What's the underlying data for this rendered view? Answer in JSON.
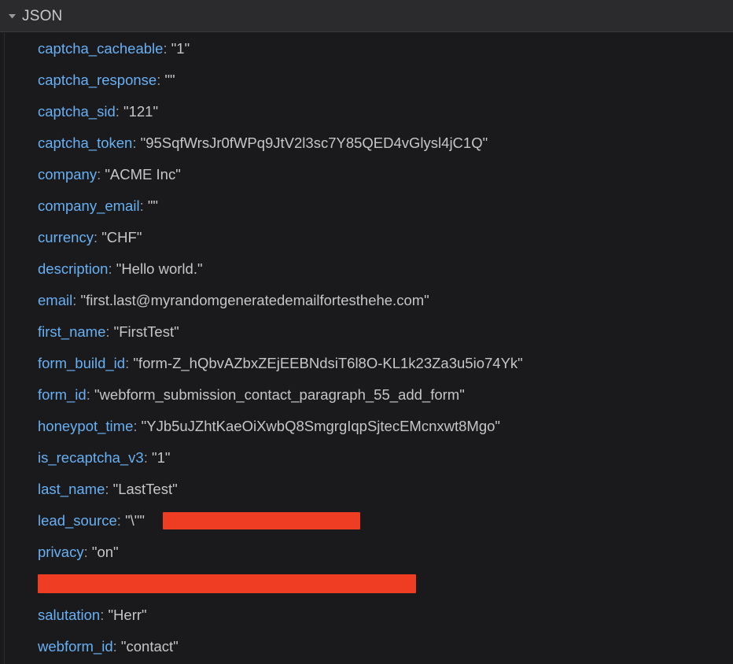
{
  "panel": {
    "title": "JSON",
    "disclosure_icon": "triangle-down-icon",
    "expanded": true,
    "colors": {
      "background": "#1a1a1c",
      "header_background": "#2b2b2e",
      "key": "#67b0f4",
      "value": "#c6c6c8",
      "punctuation": "#9a9a9e",
      "redaction": "#ee3d23"
    }
  },
  "entries": [
    {
      "key": "captcha_cacheable",
      "sep": ": ",
      "value": "\"1\"",
      "redacted": false
    },
    {
      "key": "captcha_response",
      "sep": ": ",
      "value": "\"\"",
      "redacted": false
    },
    {
      "key": "captcha_sid",
      "sep": ": ",
      "value": "\"121\"",
      "redacted": false
    },
    {
      "key": "captcha_token",
      "sep": ": ",
      "value": "\"95SqfWrsJr0fWPq9JtV2l3sc7Y85QED4vGlysl4jC1Q\"",
      "redacted": false
    },
    {
      "key": "company",
      "sep": ": ",
      "value": "\"ACME Inc\"",
      "redacted": false
    },
    {
      "key": "company_email",
      "sep": ": ",
      "value": "\"\"",
      "redacted": false
    },
    {
      "key": "currency",
      "sep": ": ",
      "value": "\"CHF\"",
      "redacted": false
    },
    {
      "key": "description",
      "sep": ": ",
      "value": "\"Hello world.\"",
      "redacted": false
    },
    {
      "key": "email",
      "sep": ": ",
      "value": "\"first.last@myrandomgeneratedemailfortesthehe.com\"",
      "redacted": false
    },
    {
      "key": "first_name",
      "sep": ": ",
      "value": "\"FirstTest\"",
      "redacted": false
    },
    {
      "key": "form_build_id",
      "sep": ": ",
      "value": "\"form-Z_hQbvAZbxZEjEEBNdsiT6l8O-KL1k23Za3u5io74Yk\"",
      "redacted": false
    },
    {
      "key": "form_id",
      "sep": ": ",
      "value": "\"webform_submission_contact_paragraph_55_add_form\"",
      "redacted": false
    },
    {
      "key": "honeypot_time",
      "sep": ": ",
      "value": "\"YJb5uJZhtKaeOiXwbQ8SmgrgIqpSjtecEMcnxwt8Mgo\"",
      "redacted": false
    },
    {
      "key": "is_recaptcha_v3",
      "sep": ": ",
      "value": "\"1\"",
      "redacted": false
    },
    {
      "key": "last_name",
      "sep": ": ",
      "value": "\"LastTest\"",
      "redacted": false
    },
    {
      "key": "lead_source",
      "sep": ": ",
      "value": "\"\\\"",
      "redacted": true,
      "redaction_id": "redaction-lead-source",
      "trailing": "\""
    },
    {
      "key": "privacy",
      "sep": ": ",
      "value": "\"on\"",
      "redacted": false
    },
    {
      "key": "",
      "sep": "",
      "value": "",
      "redacted": true,
      "redaction_id": "redaction-full-row",
      "full_row_redacted": true
    },
    {
      "key": "salutation",
      "sep": ": ",
      "value": "\"Herr\"",
      "redacted": false
    },
    {
      "key": "webform_id",
      "sep": ": ",
      "value": "\"contact\"",
      "redacted": false
    }
  ]
}
